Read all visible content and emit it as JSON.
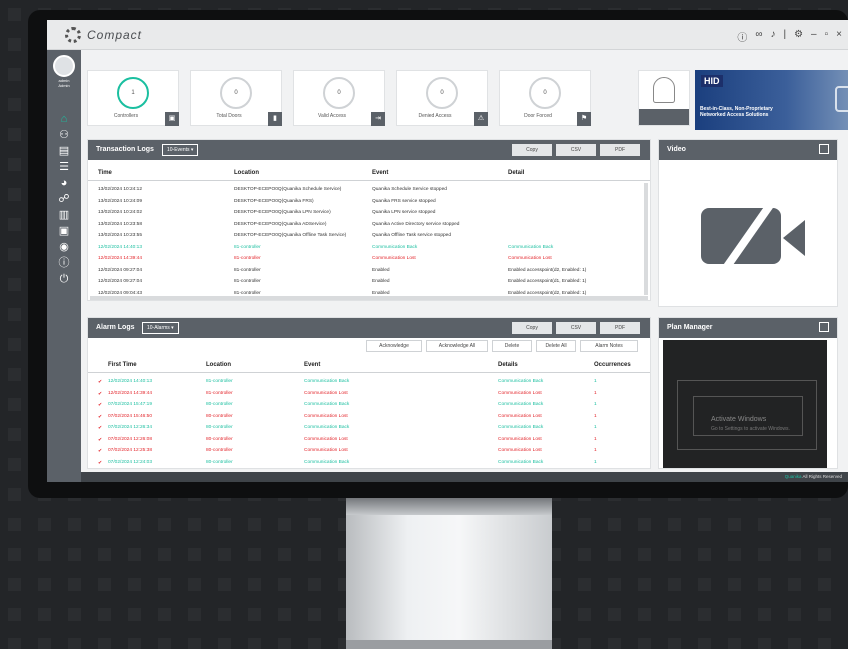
{
  "app": {
    "brand": "Compact"
  },
  "titlebar": {
    "icons": [
      "info-icon",
      "link-icon",
      "bell-icon",
      "gear-icon",
      "minimize-icon",
      "restore-icon",
      "close-icon"
    ],
    "glyphs": [
      "ⓘ",
      "∞",
      "♪",
      "|",
      "⚙",
      "–",
      "▫",
      "×"
    ]
  },
  "sidebar": {
    "user_name": "admin",
    "user_role": "Admin",
    "items": [
      "home-icon",
      "people-icon",
      "clipboard-icon",
      "sliders-icon",
      "pie-chart-icon",
      "network-icon",
      "report-icon",
      "document-icon",
      "eye-icon",
      "info-icon",
      "power-icon"
    ]
  },
  "cards": [
    {
      "label": "Controllers",
      "value": "1"
    },
    {
      "label": "Total Doors",
      "value": "0"
    },
    {
      "label": "Valid Access",
      "value": "0"
    },
    {
      "label": "Denied Access",
      "value": "0"
    },
    {
      "label": "Door Forced",
      "value": "0"
    }
  ],
  "ad": {
    "logo": "HID",
    "line1": "Best-in-Class, Non-Proprietary",
    "line2": "Networked Access Solutions"
  },
  "transactions": {
    "title": "Transaction Logs",
    "select": "10-Events",
    "buttons": [
      "Copy",
      "CSV",
      "PDF"
    ],
    "columns": [
      "Time",
      "Location",
      "Event",
      "Detail"
    ],
    "rows": [
      {
        "time": "13/02/2024 10:24:12",
        "location": "DESKTOP-ECEPO0Q(Quanika Schedule Service)",
        "event": "Quanika Schedule Service stopped",
        "detail": "",
        "status": "normal"
      },
      {
        "time": "13/02/2024 10:24:09",
        "location": "DESKTOP-ECEPO0Q(Quanika FRS)",
        "event": "Quanika FRS service stopped",
        "detail": "",
        "status": "normal"
      },
      {
        "time": "13/02/2024 10:24:02",
        "location": "DESKTOP-ECEPO0Q(Quanika LPN Service)",
        "event": "Quanika LPN service stopped",
        "detail": "",
        "status": "normal"
      },
      {
        "time": "13/02/2024 10:23:58",
        "location": "DESKTOP-ECEPO0Q(Quanika ADService)",
        "event": "Quanika Active Directory service stopped",
        "detail": "",
        "status": "normal"
      },
      {
        "time": "13/02/2024 10:23:55",
        "location": "DESKTOP-ECEPO0Q(Quanika Offline Task Service)",
        "event": "Quanika Offline Task service stopped",
        "detail": "",
        "status": "normal"
      },
      {
        "time": "12/02/2024 14:40:13",
        "location": "81-controller",
        "event": "Communication Back",
        "detail": "Communication Back",
        "status": "green"
      },
      {
        "time": "12/02/2024 14:39:44",
        "location": "81-controller",
        "event": "Communication Lost",
        "detail": "Communication Lost",
        "status": "red"
      },
      {
        "time": "12/02/2024 09:27:04",
        "location": "81-controller",
        "event": "Enabled",
        "detail": "Enabled accesspoint(d2, Enabled: 1)",
        "status": "normal"
      },
      {
        "time": "12/02/2024 09:27:04",
        "location": "81-controller",
        "event": "Enabled",
        "detail": "Enabled accesspoint(d1, Enabled: 1)",
        "status": "normal"
      },
      {
        "time": "12/02/2024 09:04:43",
        "location": "81-controller",
        "event": "Enabled",
        "detail": "Enabled accesspoint(d2, Enabled: 1)",
        "status": "normal"
      }
    ]
  },
  "alarms": {
    "title": "Alarm Logs",
    "select": "10-Alarms",
    "buttons": [
      "Copy",
      "CSV",
      "PDF"
    ],
    "actions": [
      "Acknowledge",
      "Acknowledge All",
      "Delete",
      "Delete All",
      "Alarm Notes"
    ],
    "columns": [
      "First Time",
      "Location",
      "Event",
      "Details",
      "Occurrences"
    ],
    "rows": [
      {
        "time": "12/02/2024 14:40:13",
        "location": "81-controller",
        "event": "Communication Back",
        "details": "Communication Back",
        "occ": "1",
        "status": "green"
      },
      {
        "time": "12/02/2024 14:39:44",
        "location": "81-controller",
        "event": "Communication Lost",
        "details": "Communication Lost",
        "occ": "1",
        "status": "red"
      },
      {
        "time": "07/02/2024 15:47:19",
        "location": "80-controller",
        "event": "Communication Back",
        "details": "Communication Back",
        "occ": "1",
        "status": "green"
      },
      {
        "time": "07/02/2024 15:46:50",
        "location": "80-controller",
        "event": "Communication Lost",
        "details": "Communication Lost",
        "occ": "1",
        "status": "red"
      },
      {
        "time": "07/02/2024 12:26:34",
        "location": "80-controller",
        "event": "Communication Back",
        "details": "Communication Back",
        "occ": "1",
        "status": "green"
      },
      {
        "time": "07/02/2024 12:26:08",
        "location": "80-controller",
        "event": "Communication Lost",
        "details": "Communication Lost",
        "occ": "1",
        "status": "red"
      },
      {
        "time": "07/02/2024 12:25:38",
        "location": "80-controller",
        "event": "Communication Lost",
        "details": "Communication Lost",
        "occ": "1",
        "status": "red"
      },
      {
        "time": "07/02/2024 12:24:03",
        "location": "80-controller",
        "event": "Communication Back",
        "details": "Communication Back",
        "occ": "1",
        "status": "green"
      }
    ]
  },
  "video": {
    "title": "Video"
  },
  "plan": {
    "title": "Plan Manager",
    "watermark1": "Activate Windows",
    "watermark2": "Go to Settings to activate Windows."
  },
  "footer": {
    "brand": "Quanika",
    "text": "All Rights Reserved"
  },
  "colors": {
    "accent": "#1bbfa0",
    "error": "#e3252b",
    "panel_header": "#5b6168"
  }
}
